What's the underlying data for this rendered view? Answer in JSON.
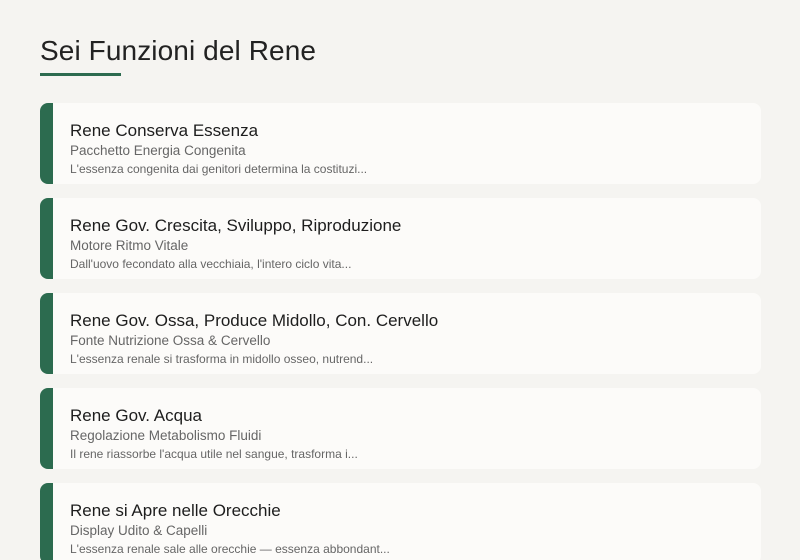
{
  "page": {
    "title": "Sei Funzioni del Rene"
  },
  "colors": {
    "accent": "#2c6b4f",
    "background": "#f5f4f1",
    "card": "#fcfbf9"
  },
  "cards": [
    {
      "title": "Rene Conserva Essenza",
      "subtitle": "Pacchetto Energia Congenita",
      "description": "L'essenza congenita dai genitori determina la costituzi..."
    },
    {
      "title": "Rene Gov. Crescita, Sviluppo, Riproduzione",
      "subtitle": "Motore Ritmo Vitale",
      "description": "Dall'uovo fecondato alla vecchiaia, l'intero ciclo vita..."
    },
    {
      "title": "Rene Gov. Ossa, Produce Midollo, Con. Cervello",
      "subtitle": "Fonte Nutrizione Ossa & Cervello",
      "description": "L'essenza renale si trasforma in midollo osseo, nutrend..."
    },
    {
      "title": "Rene Gov. Acqua",
      "subtitle": "Regolazione Metabolismo Fluidi",
      "description": "Il rene riassorbe l'acqua utile nel sangue, trasforma i..."
    },
    {
      "title": "Rene si Apre nelle Orecchie",
      "subtitle": "Display Udito & Capelli",
      "description": "L'essenza renale sale alle orecchie — essenza abbondant..."
    }
  ]
}
